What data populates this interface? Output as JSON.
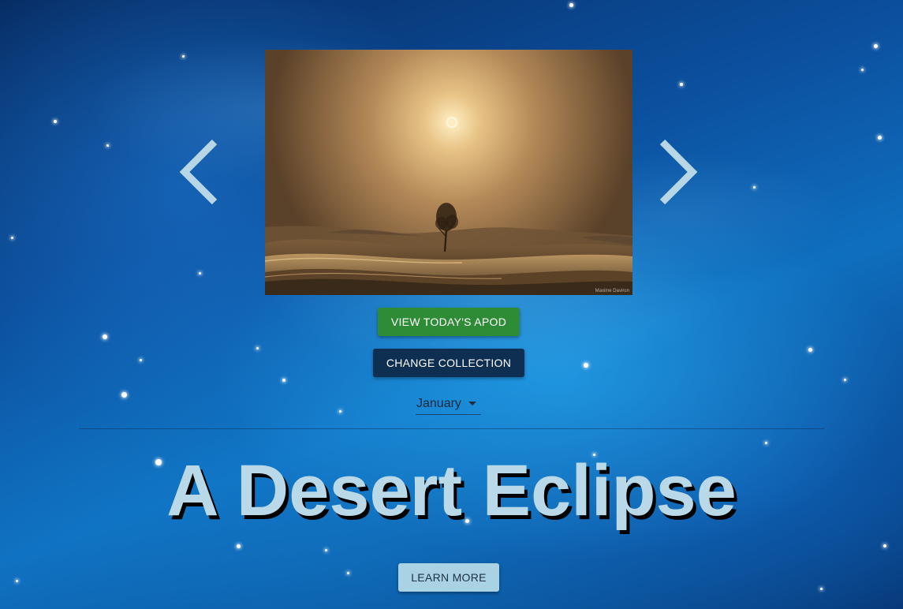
{
  "photo": {
    "alt": "A Desert Eclipse",
    "credit": "Maxime Daviron"
  },
  "navigation": {
    "prev_icon": "chevron-left-icon",
    "next_icon": "chevron-right-icon",
    "arrow_color": "#b7d6e6"
  },
  "buttons": {
    "today_label": "VIEW TODAY'S APOD",
    "collection_label": "CHANGE COLLECTION",
    "learn_more_label": "LEARN MORE"
  },
  "month_select": {
    "selected": "January"
  },
  "apod": {
    "title": "A Desert Eclipse"
  },
  "colors": {
    "today_button": "#2e8b36",
    "collection_button": "#0f2f52",
    "learn_button": "#a9d2e4",
    "title_text": "#b9d9e8"
  }
}
